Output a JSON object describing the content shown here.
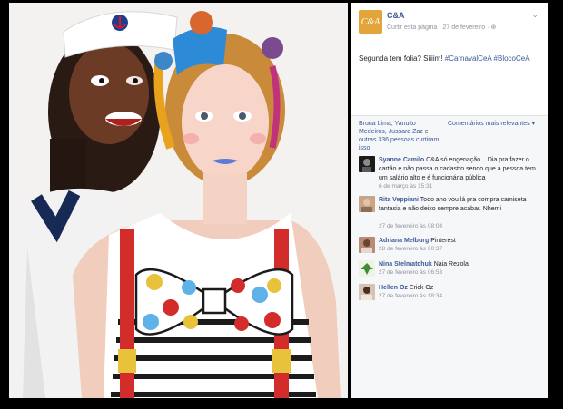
{
  "post": {
    "page_name": "C&A",
    "logo_text": "C&A",
    "follow_label": "Curtir esta página",
    "separator": "·",
    "date": "27 de fevereiro",
    "privacy_icon": "globe-icon",
    "options_icon": "chevron-down-icon",
    "text": "Segunda tem folia? Siiiim! ",
    "hashtags": "#CarnavalCeA #BlocoCeA"
  },
  "likes": {
    "names": "Bruna Lima, Yanuito Medeiros, Jussara Zaz",
    "connector": " e ",
    "others": "outras 336 pessoas curtiram isso",
    "sort_label": "Comentários mais relevantes ▾"
  },
  "comments": [
    {
      "author": "Syanne Camilo",
      "text": "C&A só engenação... Dia pra fazer o cartão e não passa o cadastro sendo que a pessoa tem um salário alto e é funcionária pública",
      "time": "6 de março às 15:31"
    },
    {
      "author": "Rita Veppiani",
      "text": "Todo ano vou lá pra compra camiseta fantasia e não deixo sempre acabar. Nhemi",
      "time": "27 de fevereiro às 08:04"
    },
    {
      "author": "Adriana Melburg",
      "text": "Pinterest",
      "time": "28 de fevereiro às 00:37"
    },
    {
      "author": "Nina Stelmatchuk",
      "text": "Naia Rezola",
      "time": "27 de fevereiro às 06:53"
    },
    {
      "author": "Hellen Oz",
      "text": "Erick Oz",
      "time": "27 de fevereiro às 18:34"
    }
  ],
  "colors": {
    "link": "#3b5998",
    "logo_bg": "#e3a43a",
    "muted": "#90949c"
  }
}
